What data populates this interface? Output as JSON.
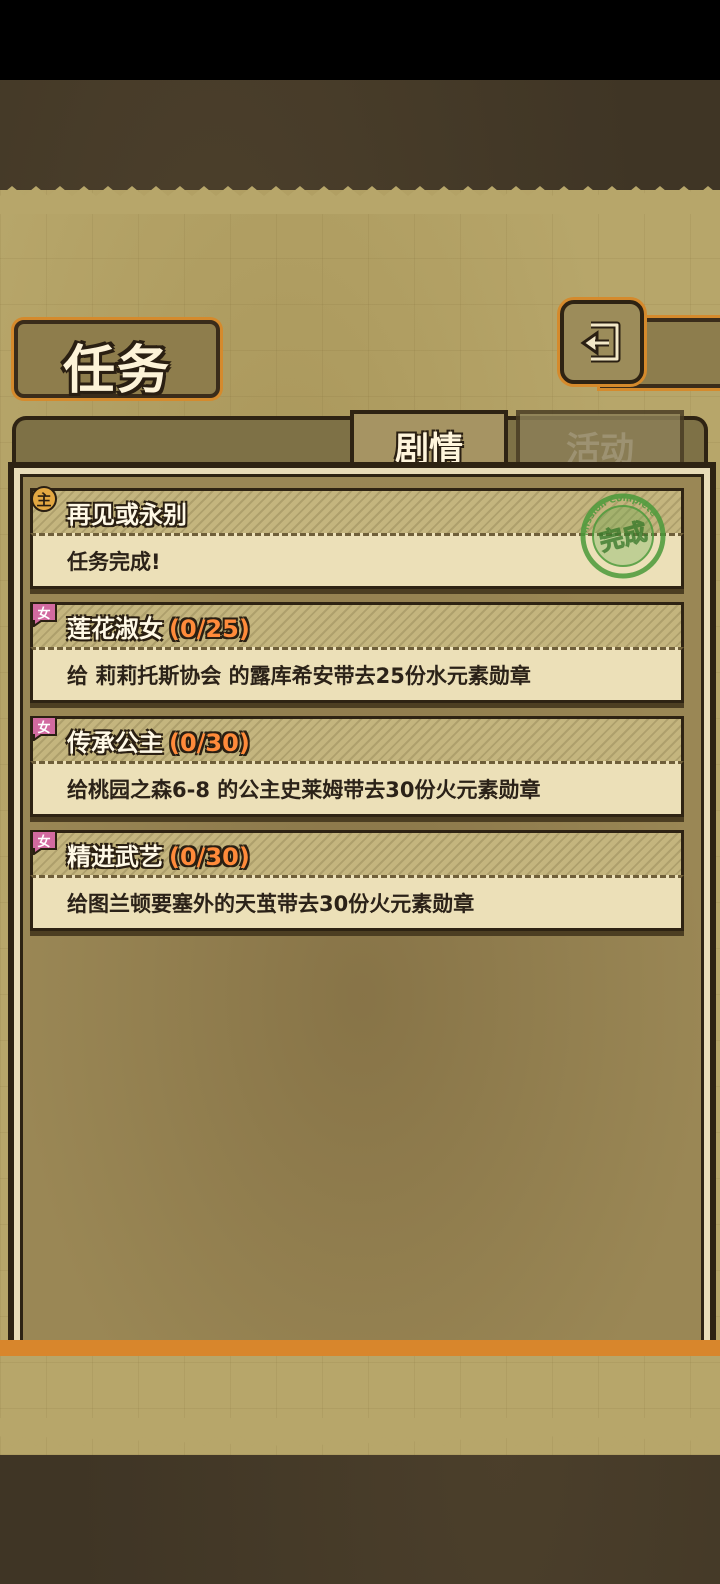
{
  "header": {
    "title": "任务"
  },
  "tabs": [
    {
      "label": "剧情",
      "active": true
    },
    {
      "label": "活动",
      "active": false
    }
  ],
  "quests": [
    {
      "badge": "主",
      "badge_color": "#e3a842",
      "title": "再见或永别",
      "progress": "",
      "desc": "任务完成!",
      "completed": true,
      "stamp_label": "完成",
      "stamp_ring_text": "Mission Complete"
    },
    {
      "badge": "女",
      "badge_color": "#d26aa0",
      "title": "莲花淑女",
      "progress": "(0/25)",
      "desc": "给 莉莉托斯协会 的露库希安带去25份水元素勋章",
      "completed": false
    },
    {
      "badge": "女",
      "badge_color": "#d26aa0",
      "title": "传承公主",
      "progress": "(0/30)",
      "desc": "给桃园之森6-8 的公主史莱姆带去30份火元素勋章",
      "completed": false
    },
    {
      "badge": "女",
      "badge_color": "#d26aa0",
      "title": "精进武艺",
      "progress": "(0/30)",
      "desc": "给图兰顿要塞外的天茧带去30份火元素勋章",
      "completed": false
    }
  ],
  "colors": {
    "accent_orange": "#d8862c",
    "progress_text": "#ff8a3a",
    "stamp_green": "#4a9a3a"
  }
}
